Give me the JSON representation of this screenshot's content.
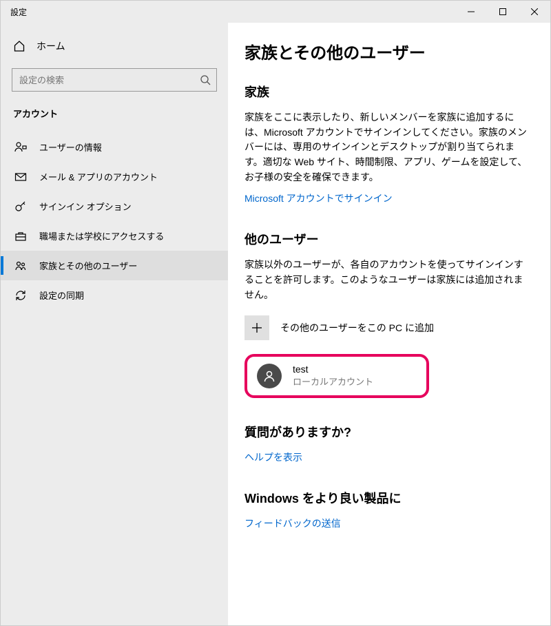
{
  "window": {
    "title": "設定"
  },
  "sidebar": {
    "home": "ホーム",
    "searchPlaceholder": "設定の検索",
    "category": "アカウント",
    "items": [
      {
        "label": "ユーザーの情報"
      },
      {
        "label": "メール & アプリのアカウント"
      },
      {
        "label": "サインイン オプション"
      },
      {
        "label": "職場または学校にアクセスする"
      },
      {
        "label": "家族とその他のユーザー"
      },
      {
        "label": "設定の同期"
      }
    ]
  },
  "main": {
    "title": "家族とその他のユーザー",
    "family": {
      "heading": "家族",
      "body": "家族をここに表示したり、新しいメンバーを家族に追加するには、Microsoft アカウントでサインインしてください。家族のメンバーには、専用のサインインとデスクトップが割り当てられます。適切な Web サイト、時間制限、アプリ、ゲームを設定して、お子様の安全を確保できます。",
      "link": "Microsoft アカウントでサインイン"
    },
    "others": {
      "heading": "他のユーザー",
      "body": "家族以外のユーザーが、各自のアカウントを使ってサインインすることを許可します。このようなユーザーは家族には追加されません。",
      "addLabel": "その他のユーザーをこの PC に追加",
      "user": {
        "name": "test",
        "type": "ローカルアカウント"
      }
    },
    "help": {
      "heading": "質問がありますか?",
      "link": "ヘルプを表示"
    },
    "feedback": {
      "heading": "Windows をより良い製品に",
      "link": "フィードバックの送信"
    }
  }
}
